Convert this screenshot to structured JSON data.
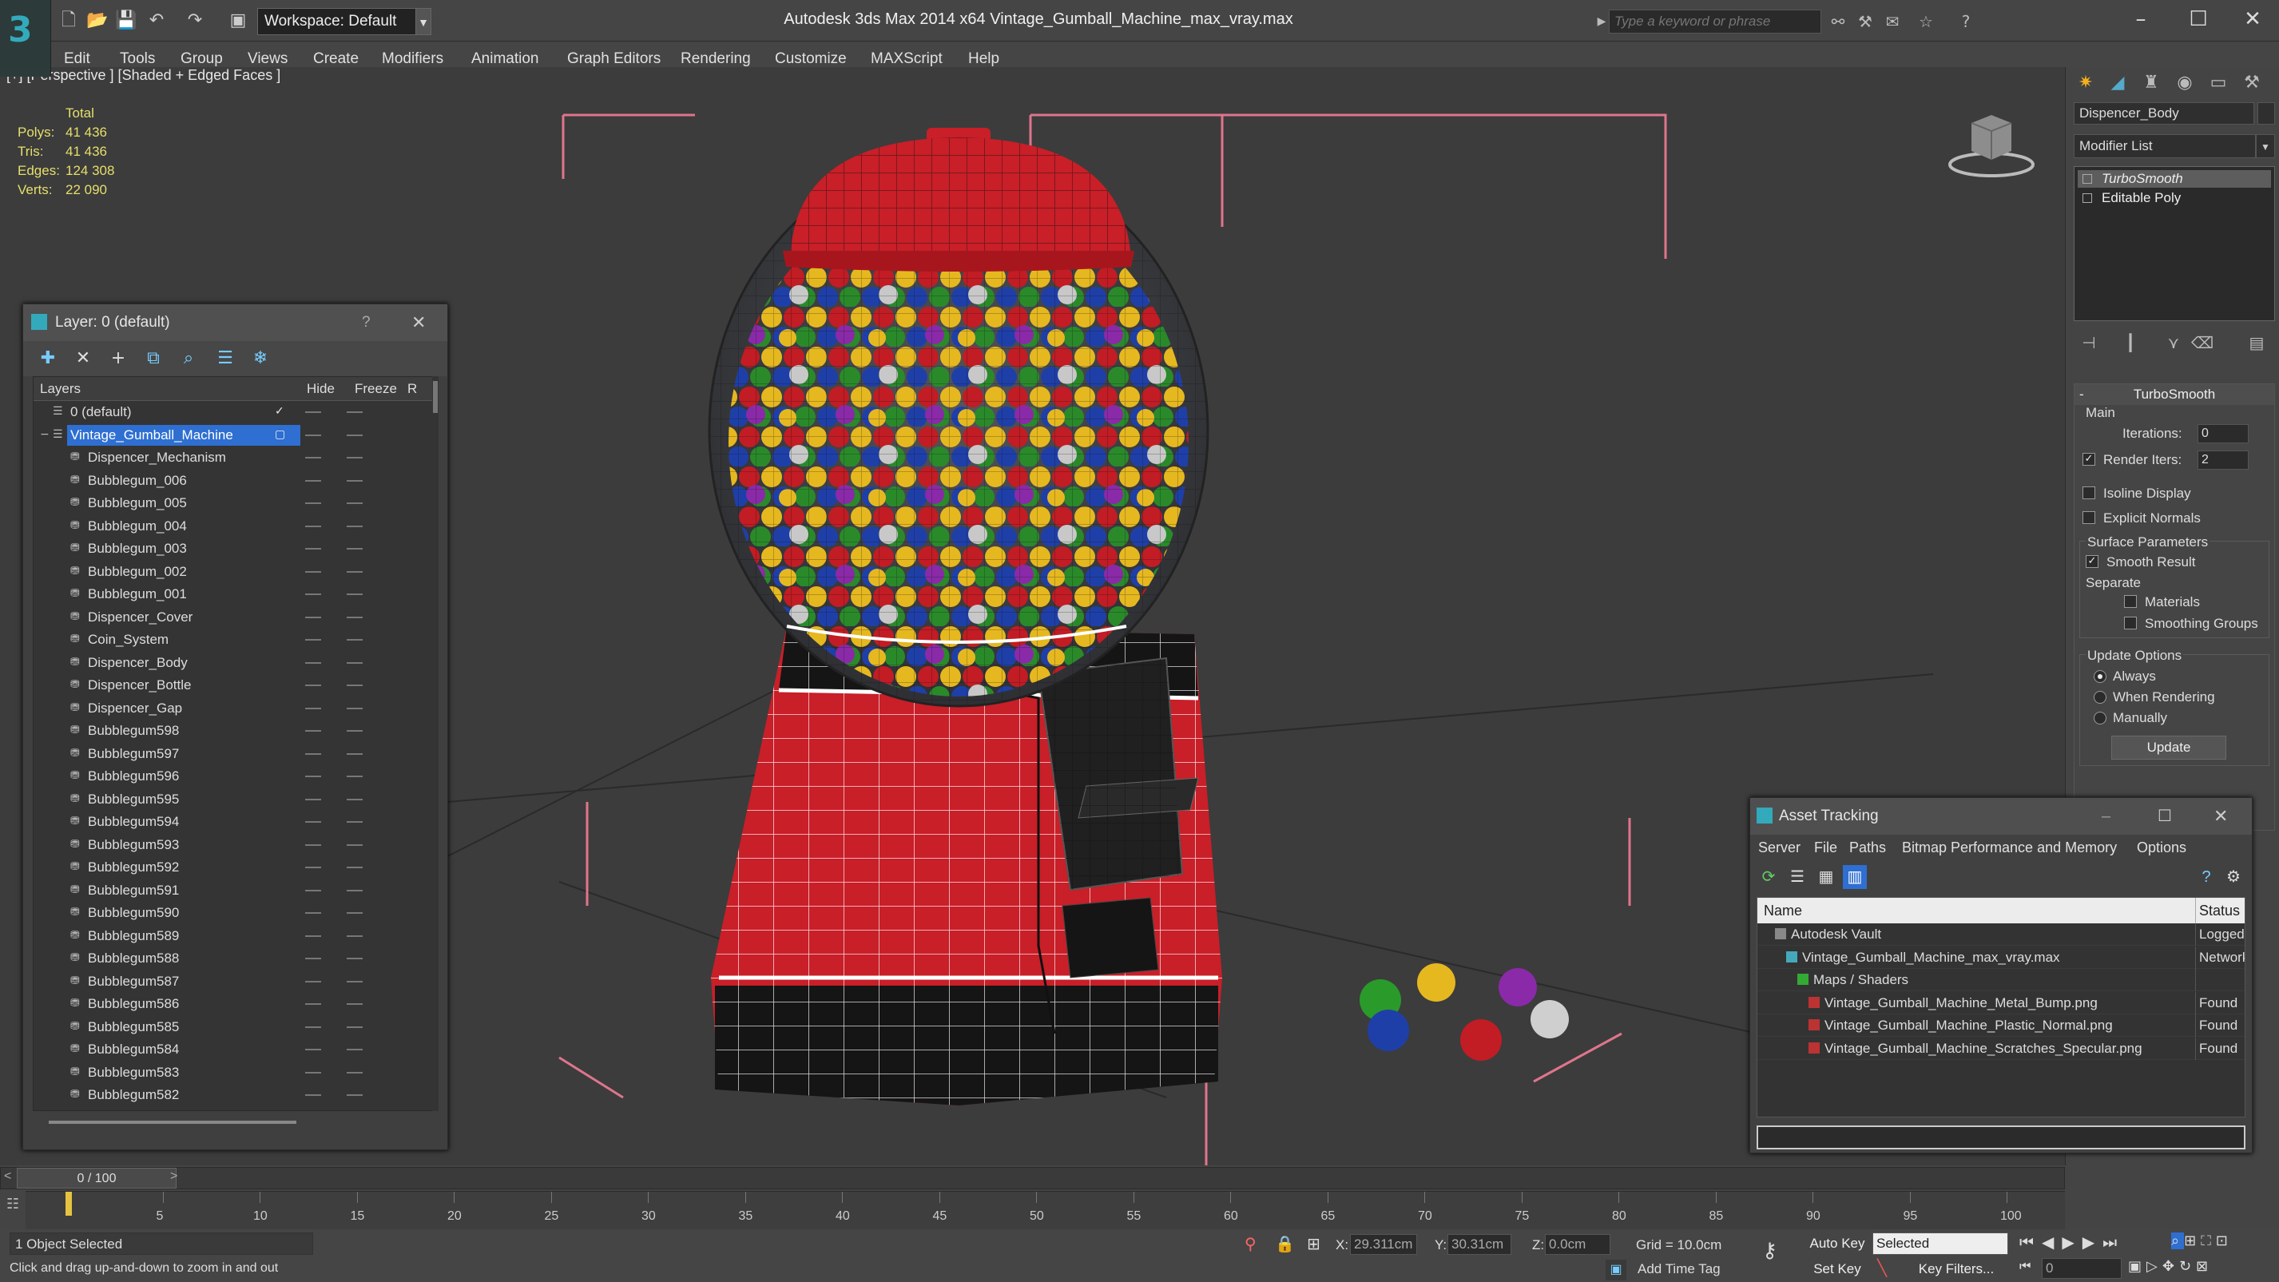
{
  "app": {
    "title": "Autodesk 3ds Max  2014 x64       Vintage_Gumball_Machine_max_vray.max",
    "workspace": "Workspace: Default",
    "search_placeholder": "Type a keyword or phrase"
  },
  "menu": [
    "Edit",
    "Tools",
    "Group",
    "Views",
    "Create",
    "Modifiers",
    "Animation",
    "Graph Editors",
    "Rendering",
    "Customize",
    "MAXScript",
    "Help"
  ],
  "viewport": {
    "label": "[+] [Perspective ] [Shaded + Edged Faces ]",
    "stats": {
      "header": "Total",
      "rows": [
        {
          "key": "Polys:",
          "value": "41 436"
        },
        {
          "key": "Tris:",
          "value": "41 436"
        },
        {
          "key": "Edges:",
          "value": "124 308"
        },
        {
          "key": "Verts:",
          "value": "22 090"
        }
      ]
    }
  },
  "command_panel": {
    "object_name": "Dispencer_Body",
    "modifier_list": "Modifier List",
    "stack": [
      "TurboSmooth",
      "Editable Poly"
    ],
    "rollout_title": "TurboSmooth",
    "main_label": "Main",
    "iterations_label": "Iterations:",
    "iterations_value": "0",
    "render_iters_label": "Render Iters:",
    "render_iters_value": "2",
    "isoline_label": "Isoline Display",
    "explicit_label": "Explicit Normals",
    "surface_label": "Surface Parameters",
    "smooth_label": "Smooth Result",
    "separate_label": "Separate",
    "materials_label": "Materials",
    "smoothing_groups_label": "Smoothing Groups",
    "update_options_label": "Update Options",
    "always_label": "Always",
    "when_rendering_label": "When Rendering",
    "manually_label": "Manually",
    "update_button": "Update"
  },
  "layer_window": {
    "title": "Layer: 0 (default)",
    "help": "?",
    "col_layers": "Layers",
    "col_hide": "Hide",
    "col_freeze": "Freeze",
    "col_extra": "R",
    "layers": [
      {
        "name": "0 (default)",
        "level": 0,
        "type": "layer",
        "current": true
      },
      {
        "name": "Vintage_Gumball_Machine",
        "level": 0,
        "type": "layer",
        "selected": true
      },
      {
        "name": "Dispencer_Mechanism",
        "level": 1
      },
      {
        "name": "Bubblegum_006",
        "level": 1
      },
      {
        "name": "Bubblegum_005",
        "level": 1
      },
      {
        "name": "Bubblegum_004",
        "level": 1
      },
      {
        "name": "Bubblegum_003",
        "level": 1
      },
      {
        "name": "Bubblegum_002",
        "level": 1
      },
      {
        "name": "Bubblegum_001",
        "level": 1
      },
      {
        "name": "Dispencer_Cover",
        "level": 1
      },
      {
        "name": "Coin_System",
        "level": 1
      },
      {
        "name": "Dispencer_Body",
        "level": 1
      },
      {
        "name": "Dispencer_Bottle",
        "level": 1
      },
      {
        "name": "Dispencer_Gap",
        "level": 1
      },
      {
        "name": "Bubblegum598",
        "level": 1
      },
      {
        "name": "Bubblegum597",
        "level": 1
      },
      {
        "name": "Bubblegum596",
        "level": 1
      },
      {
        "name": "Bubblegum595",
        "level": 1
      },
      {
        "name": "Bubblegum594",
        "level": 1
      },
      {
        "name": "Bubblegum593",
        "level": 1
      },
      {
        "name": "Bubblegum592",
        "level": 1
      },
      {
        "name": "Bubblegum591",
        "level": 1
      },
      {
        "name": "Bubblegum590",
        "level": 1
      },
      {
        "name": "Bubblegum589",
        "level": 1
      },
      {
        "name": "Bubblegum588",
        "level": 1
      },
      {
        "name": "Bubblegum587",
        "level": 1
      },
      {
        "name": "Bubblegum586",
        "level": 1
      },
      {
        "name": "Bubblegum585",
        "level": 1
      },
      {
        "name": "Bubblegum584",
        "level": 1
      },
      {
        "name": "Bubblegum583",
        "level": 1
      },
      {
        "name": "Bubblegum582",
        "level": 1
      }
    ]
  },
  "asset_window": {
    "title": "Asset Tracking",
    "menu": [
      "Server",
      "File",
      "Paths",
      "Bitmap Performance and Memory",
      "Options"
    ],
    "col_name": "Name",
    "col_status": "Status",
    "rows": [
      {
        "name": "Autodesk Vault",
        "status": "Logged",
        "level": 1
      },
      {
        "name": "Vintage_Gumball_Machine_max_vray.max",
        "status": "Network",
        "level": 2
      },
      {
        "name": "Maps / Shaders",
        "status": "",
        "level": 3
      },
      {
        "name": "Vintage_Gumball_Machine_Metal_Bump.png",
        "status": "Found",
        "level": 4
      },
      {
        "name": "Vintage_Gumball_Machine_Plastic_Normal.png",
        "status": "Found",
        "level": 4
      },
      {
        "name": "Vintage_Gumball_Machine_Scratches_Specular.png",
        "status": "Found",
        "level": 4
      }
    ]
  },
  "timeline": {
    "frame": "0 / 100",
    "ticks": [
      "5",
      "10",
      "15",
      "20",
      "25",
      "30",
      "35",
      "40",
      "45",
      "50",
      "55",
      "60",
      "65",
      "70",
      "75",
      "80",
      "85",
      "90",
      "95",
      "100"
    ]
  },
  "status": {
    "selection": "1 Object Selected",
    "hint": "Click and drag up-and-down to zoom in and out",
    "x_label": "X:",
    "x_value": "29.311cm",
    "y_label": "Y:",
    "y_value": "30.31cm",
    "z_label": "Z:",
    "z_value": "0.0cm",
    "grid": "Grid = 10.0cm",
    "auto_key": "Auto Key",
    "set_key": "Set Key",
    "selected_dropdown": "Selected",
    "key_filters": "Key Filters...",
    "add_time_tag": "Add Time Tag",
    "frame_field": "0"
  },
  "colors": {
    "accent": "#2e6fd1",
    "stats_text": "#e6df6c",
    "machine_red": "#d6222c",
    "bbox_pink": "#e0758c"
  }
}
